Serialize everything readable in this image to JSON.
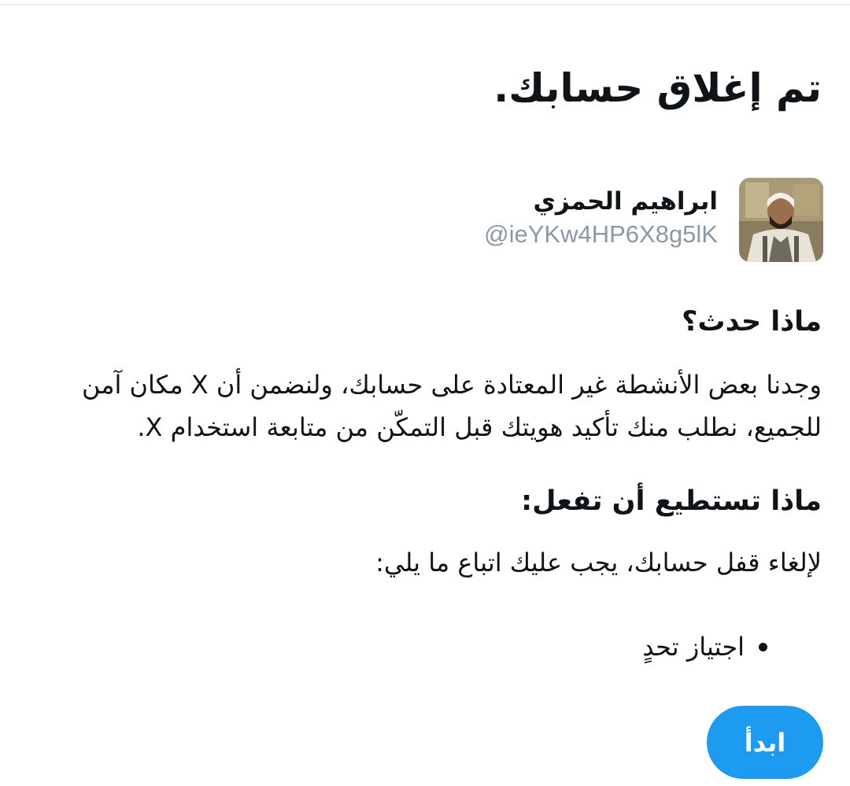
{
  "title": "تم إغلاق حسابك.",
  "account": {
    "display_name": "ابراهيم الحمزي",
    "handle": "@ieYKw4HP6X8g5lK"
  },
  "what_happened": {
    "heading": "ماذا حدث؟",
    "body": "وجدنا بعض الأنشطة غير المعتادة على حسابك، ولنضمن أن X مكان آمن للجميع، نطلب منك تأكيد هويتك قبل التمكّن من متابعة استخدام X."
  },
  "what_you_can_do": {
    "heading": "ماذا تستطيع أن تفعل:",
    "body": "لإلغاء قفل حسابك، يجب عليك اتباع ما يلي:",
    "steps": [
      "اجتياز تحدٍ"
    ]
  },
  "start_button": {
    "label": "ابدأ"
  },
  "colors": {
    "accent": "#1d9bf0",
    "text": "#0f1419",
    "secondary_text": "#8b98a5"
  }
}
